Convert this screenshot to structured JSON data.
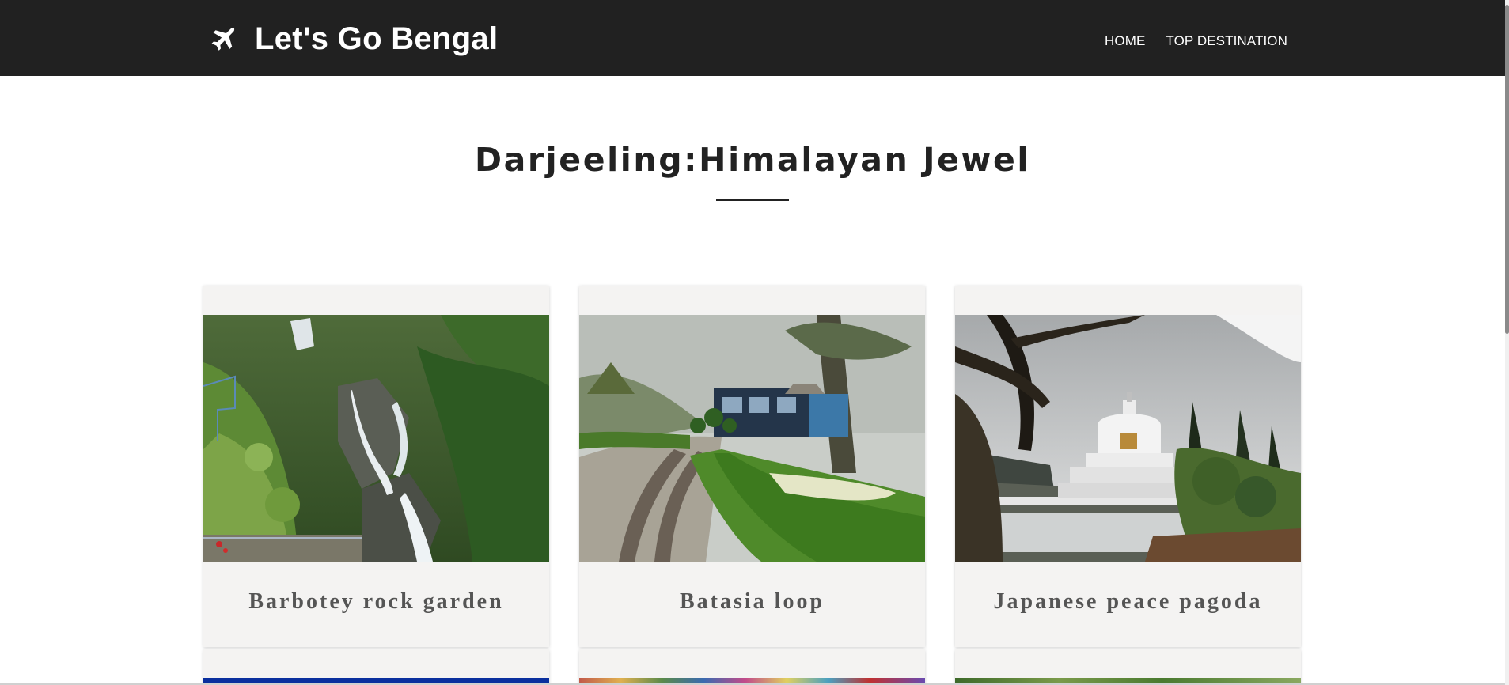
{
  "navbar": {
    "brand": "Let's Go Bengal",
    "links": [
      "HOME",
      "TOP DESTINATION"
    ]
  },
  "section": {
    "title": "Darjeeling:Himalayan Jewel"
  },
  "cards": [
    {
      "title": "Barbotey rock garden",
      "image": "waterfall-photo"
    },
    {
      "title": "Batasia loop",
      "image": "toy-train-photo"
    },
    {
      "title": "Japanese peace pagoda",
      "image": "pagoda-photo"
    }
  ],
  "colors": {
    "navbar_bg": "#212121",
    "card_bg": "#f4f3f2",
    "heading": "#222222",
    "card_title": "#555555"
  }
}
